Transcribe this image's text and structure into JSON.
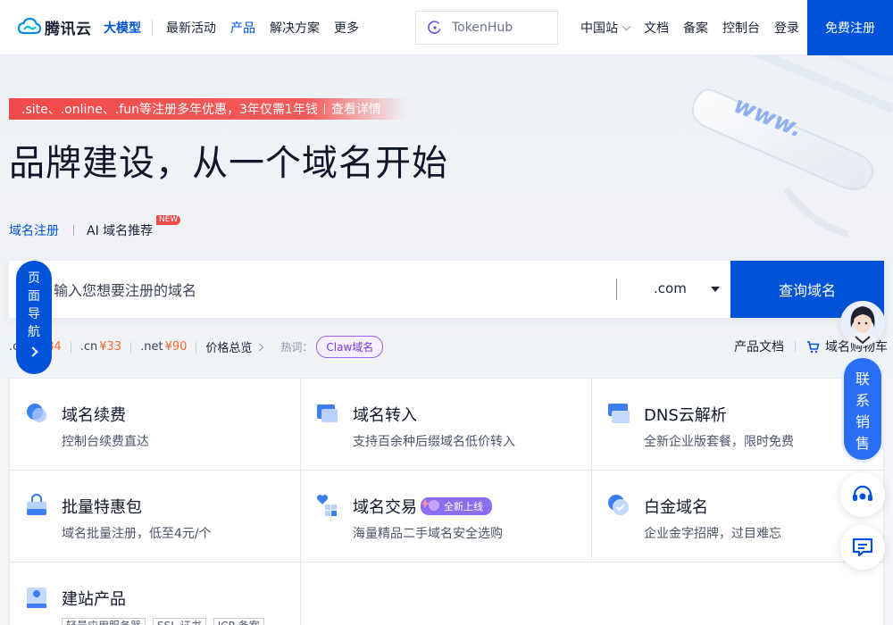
{
  "header": {
    "logo_text": "腾讯云",
    "brand_tag": "大模型",
    "nav": [
      "最新活动",
      "产品",
      "解决方案",
      "更多"
    ],
    "active_nav": "产品",
    "search_placeholder": "TokenHub",
    "site": "中国站",
    "links": [
      "文档",
      "备案",
      "控制台",
      "登录"
    ],
    "signup": "免费注册"
  },
  "hero": {
    "promo_text": ".site、.online、.fun等注册多年优惠，3年仅需1年钱",
    "promo_link": "查看详情",
    "title": "品牌建设，从一个域名开始",
    "tab_register": "域名注册",
    "tab_ai": "AI 域名推荐",
    "new_badge": "NEW"
  },
  "domain_search": {
    "placeholder": "输入您想要注册的域名",
    "tld": ".com",
    "button": "查询域名"
  },
  "prices": [
    {
      "tld": ".com",
      "price": "¥84"
    },
    {
      "tld": ".cn",
      "price": "¥33"
    },
    {
      "tld": ".net",
      "price": "¥90"
    }
  ],
  "price_overview": "价格总览",
  "hot_label": "热词：",
  "hot_tag": "Claw域名",
  "product_docs": "产品文档",
  "cart": "域名购物车",
  "products": [
    {
      "name": "域名续费",
      "desc": "控制台续费直达"
    },
    {
      "name": "域名转入",
      "desc": "支持百余种后缀域名低价转入"
    },
    {
      "name": "DNS云解析",
      "desc": "全新企业版套餐，限时免费"
    },
    {
      "name": "批量特惠包",
      "desc": "域名批量注册，低至4元/个"
    },
    {
      "name": "域名交易",
      "desc": "海量精品二手域名安全选购",
      "badge": "全新上线"
    },
    {
      "name": "白金域名",
      "desc": "企业金字招牌，过目难忘"
    },
    {
      "name": "建站产品",
      "tags": [
        "轻量应用服务器",
        "SSL 证书",
        "ICP 备案"
      ]
    }
  ],
  "floating": {
    "page_nav": [
      "页",
      "面",
      "导",
      "航"
    ],
    "contact_sales": [
      "联",
      "系",
      "销",
      "售"
    ]
  },
  "colors": {
    "brand": "#0052d9",
    "promo": "#f24a4a",
    "price": "#f46b2e",
    "hot": "#7a3fd6"
  }
}
